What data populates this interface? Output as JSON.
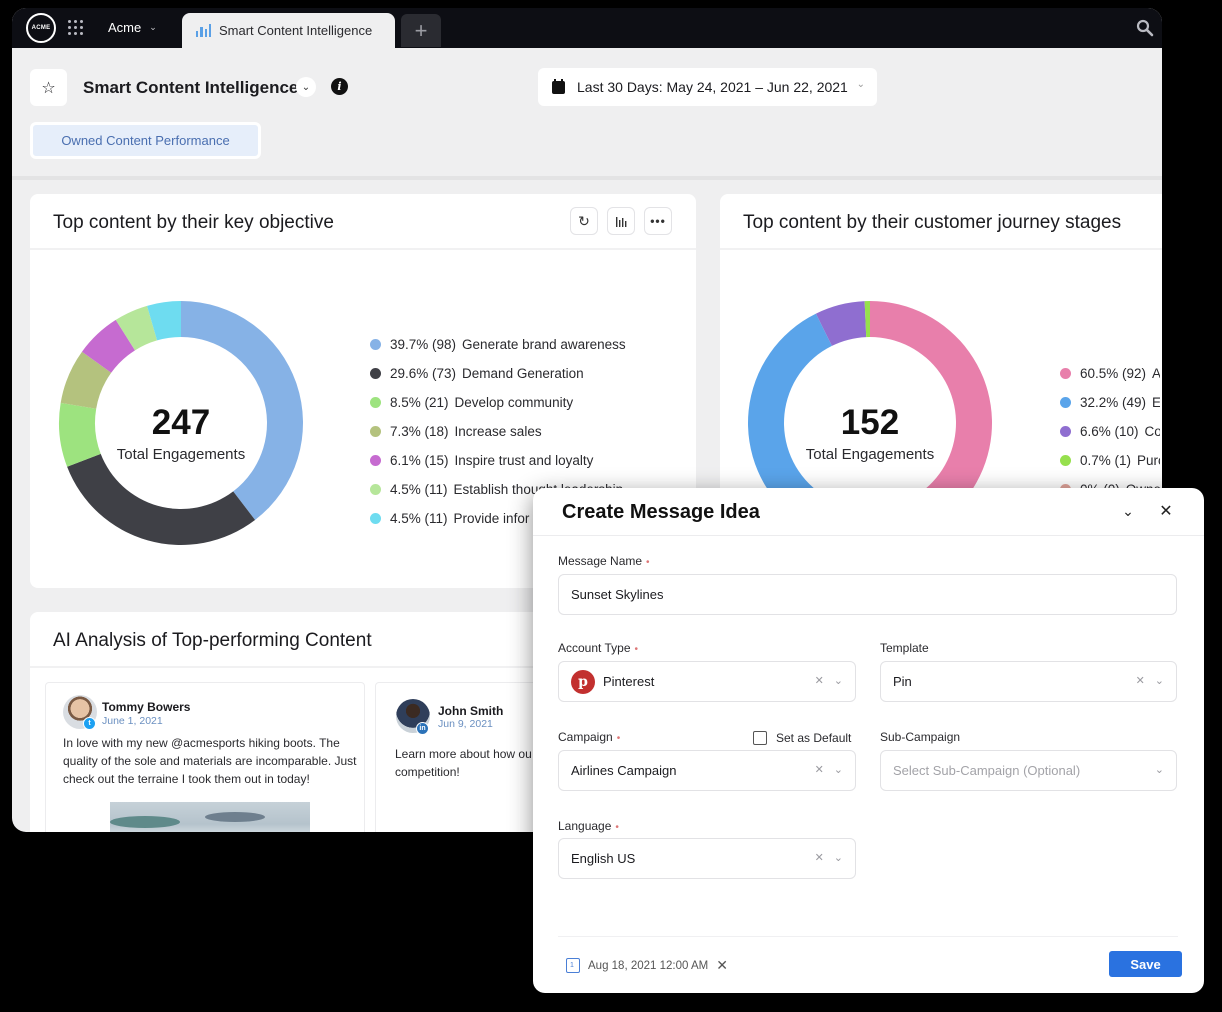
{
  "topbar": {
    "logo_text": "ACME",
    "org_name": "Acme",
    "active_tab": "Smart Content Intelligence",
    "new_tab_label": "+"
  },
  "header": {
    "title": "Smart Content Intelligence",
    "date_range": "Last 30 Days: May 24, 2021 – Jun 22, 2021",
    "view_pill": "Owned Content Performance"
  },
  "objective_card": {
    "title": "Top content by their key objective",
    "total": "247",
    "total_label": "Total Engagements"
  },
  "journey_card": {
    "title": "Top content by their customer journey stages",
    "total": "152",
    "total_label": "Total Engagements"
  },
  "chart_data": [
    {
      "type": "pie",
      "title": "Top content by their key objective",
      "center_value": 247,
      "center_label": "Total Engagements",
      "legend_position": "right",
      "slices": [
        {
          "label": "Generate brand awareness",
          "percent": 39.7,
          "count": 98,
          "color": "#86b2e6",
          "pct_text": "39.7% (98)"
        },
        {
          "label": "Demand Generation",
          "percent": 29.6,
          "count": 73,
          "color": "#3f4046",
          "pct_text": "29.6% (73)"
        },
        {
          "label": "Develop community",
          "percent": 8.5,
          "count": 21,
          "color": "#9de37f",
          "pct_text": "8.5% (21)"
        },
        {
          "label": "Increase sales",
          "percent": 7.3,
          "count": 18,
          "color": "#b4c27e",
          "pct_text": "7.3% (18)"
        },
        {
          "label": "Inspire trust and loyalty",
          "percent": 6.1,
          "count": 15,
          "color": "#c66bd0",
          "pct_text": "6.1% (15)"
        },
        {
          "label": "Establish thought leadership",
          "percent": 4.5,
          "count": 11,
          "color": "#b6e69a",
          "pct_text": "4.5% (11)"
        },
        {
          "label": "Provide infor",
          "percent": 4.5,
          "count": 11,
          "color": "#6edcf0",
          "pct_text": "4.5% (11)"
        }
      ]
    },
    {
      "type": "pie",
      "title": "Top content by their customer journey stages",
      "center_value": 152,
      "center_label": "Total Engagements",
      "legend_position": "right",
      "slices": [
        {
          "label": "A",
          "percent": 60.5,
          "count": 92,
          "color": "#e87fab",
          "pct_text": "60.5% (92)"
        },
        {
          "label": "E",
          "percent": 32.2,
          "count": 49,
          "color": "#5aa4ea",
          "pct_text": "32.2% (49)"
        },
        {
          "label": "Co",
          "percent": 6.6,
          "count": 10,
          "color": "#8f6ed0",
          "pct_text": "6.6% (10)"
        },
        {
          "label": "Purc",
          "percent": 0.7,
          "count": 1,
          "color": "#96e04d",
          "pct_text": "0.7% (1)"
        },
        {
          "label": "Owne",
          "percent": 0,
          "count": 0,
          "color": "#e0a39a",
          "pct_text": "0% (0)"
        }
      ]
    }
  ],
  "ai_card": {
    "title": "AI Analysis of Top-performing Content",
    "posts": [
      {
        "author": "Tommy Bowers",
        "date": "June 1, 2021",
        "network": "twitter",
        "body": "In love with my new @acmesports hiking boots. The quality of the sole and materials are incomparable. Just check out the terraine I took them out in today!"
      },
      {
        "author": "John Smith",
        "date": "Jun 9, 2021",
        "network": "linkedin",
        "body": "Learn more about how ou competition!"
      }
    ]
  },
  "modal": {
    "title": "Create Message Idea",
    "message_name_label": "Message Name",
    "message_name_value": "Sunset Skylines",
    "account_type_label": "Account Type",
    "account_type_value": "Pinterest",
    "template_label": "Template",
    "template_value": "Pin",
    "campaign_label": "Campaign",
    "set_default_label": "Set as Default",
    "set_default_checked": false,
    "campaign_value": "Airlines Campaign",
    "subcampaign_label": "Sub-Campaign",
    "subcampaign_placeholder": "Select Sub-Campaign (Optional)",
    "language_label": "Language",
    "language_value": "English US",
    "schedule": "Aug 18, 2021 12:00 AM",
    "save_label": "Save",
    "required_mark": "•",
    "clear_glyph": "✕",
    "chevron_glyph": "⌄"
  }
}
